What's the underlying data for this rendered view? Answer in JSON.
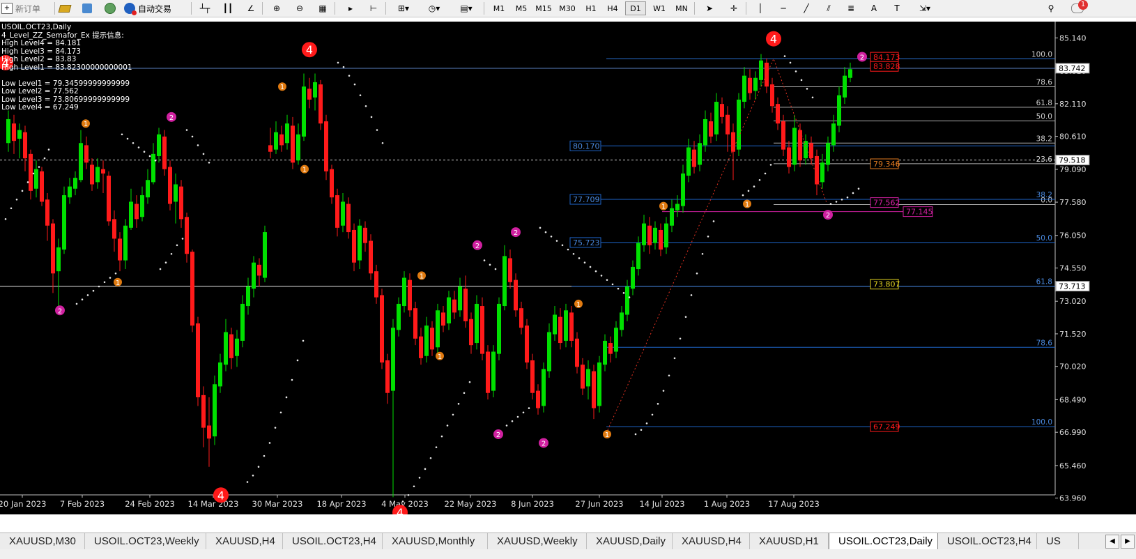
{
  "toolbar": {
    "new_order": "新订单",
    "auto_trade": "自动交易",
    "timeframes": [
      "M1",
      "M5",
      "M15",
      "M30",
      "H1",
      "H4",
      "D1",
      "W1",
      "MN"
    ],
    "active_timeframe": "D1",
    "notification_count": "1"
  },
  "info_panel": {
    "symbol_line": "USOIL.OCT23,Daily",
    "indicator_line": "4_Level_ZZ_Semafor_Ex 提示信息:",
    "lines": [
      "High Level4 = 84.181",
      "High Level3 = 84.173",
      "High Level2 = 83.83",
      "High Level1 = 83.82300000000001",
      "",
      "Low Level1 = 79.34599999999999",
      "Low Level2 = 77.562",
      "Low Level3 = 73.80699999999999",
      "Low Level4 = 67.249"
    ]
  },
  "price_axis": {
    "min": 63.21,
    "max": 85.89,
    "labels": [
      "85.140",
      "83.610",
      "82.110",
      "80.610",
      "79.090",
      "77.580",
      "76.050",
      "74.550",
      "73.020",
      "71.520",
      "70.020",
      "68.490",
      "66.990",
      "65.460",
      "63.960"
    ],
    "current_price": "83.742",
    "hline_price": "79.518",
    "white_line_price": "73.713"
  },
  "date_axis": [
    "20 Jan 2023",
    "7 Feb 2023",
    "24 Feb 2023",
    "14 Mar 2023",
    "30 Mar 2023",
    "18 Apr 2023",
    "4 May 2023",
    "22 May 2023",
    "8 Jun 2023",
    "27 Jun 2023",
    "14 Jul 2023",
    "1 Aug 2023",
    "17 Aug 2023"
  ],
  "fib_left": {
    "labels": [
      "80.170",
      "77.709",
      "75.723"
    ],
    "pct_labels": [
      "100.0",
      "78.6",
      "61.8",
      "50.0",
      "38.2",
      "23.6",
      "0.0"
    ]
  },
  "fib_right": {
    "pct_labels": [
      "38.2",
      "50.0",
      "61.8",
      "78.6",
      "100.0"
    ]
  },
  "level_boxes": {
    "high4": "84.173",
    "high1": "83.828",
    "low1": "79.346",
    "low2": "77.562",
    "low2_ext": "77.145",
    "low3": "73.807",
    "low4": "67.249"
  },
  "semafor_labels": [
    "1",
    "2",
    "4"
  ],
  "tabs": [
    "XAUUSD,M30",
    "USOIL.OCT23,Weekly",
    "XAUUSD,H4",
    "USOIL.OCT23,H4",
    "XAUUSD,Monthly",
    "XAUUSD,Weekly",
    "XAUUSD,Daily",
    "XAUUSD,H4",
    "XAUUSD,H1",
    "USOIL.OCT23,Daily",
    "USOIL.OCT23,H4",
    "US"
  ],
  "active_tab": "USOIL.OCT23,Daily",
  "colors": {
    "bull": "#00e000",
    "bear": "#ff1a1a",
    "grid_blue": "#1e64c8",
    "semafor1": "#e07a10",
    "semafor2": "#d020a0",
    "semafor4": "#ff1a1a"
  }
}
